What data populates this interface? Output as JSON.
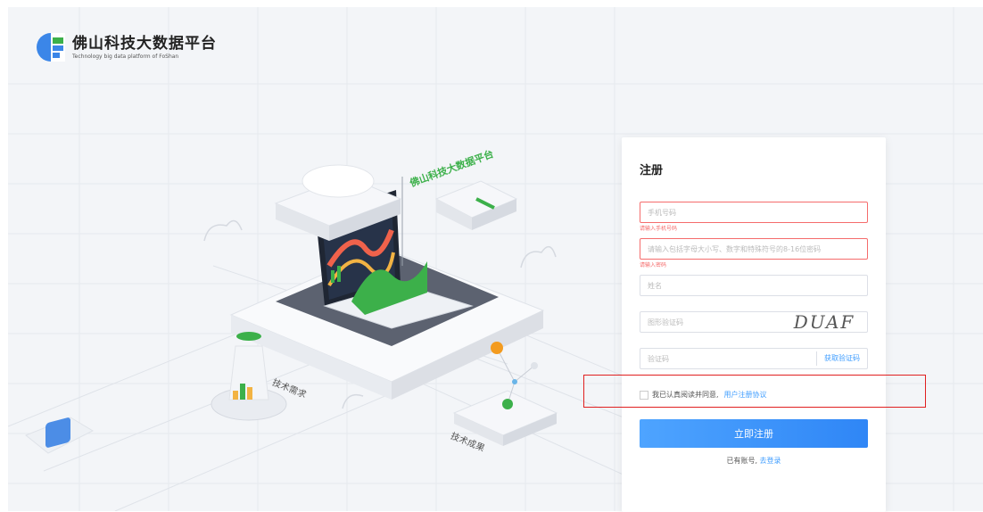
{
  "logo": {
    "title": "佛山科技大数据平台",
    "subtitle": "Technology big data platform of FoShan"
  },
  "illustration": {
    "platform_label": "佛山科技大数据平台",
    "label_left": "技术需求",
    "label_bottom": "技术成果"
  },
  "register": {
    "title": "注册",
    "phone_placeholder": "手机号码",
    "phone_error": "请输入手机号码",
    "password_placeholder": "请输入包括字母大小写、数字和特殊符号的8-16位密码",
    "password_error": "请输入密码",
    "name_placeholder": "姓名",
    "captcha_placeholder": "图形验证码",
    "captcha_text": "DUAF",
    "code_placeholder": "验证码",
    "get_code_label": "获取验证码",
    "agree_text": "我已认真阅读并同意,",
    "agreement_link": "用户注册协议",
    "submit_label": "立即注册",
    "has_account_text": "已有账号,",
    "login_link": "去登录"
  },
  "colors": {
    "accent": "#409eff",
    "error": "#f56c6c",
    "highlight": "#e02020",
    "brand_green": "#3cb04a"
  }
}
